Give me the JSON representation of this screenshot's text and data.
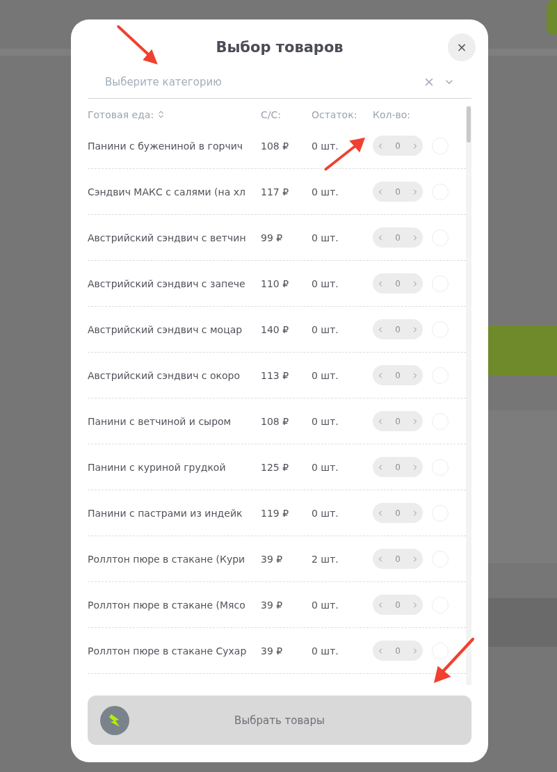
{
  "dialog": {
    "title": "Выбор товаров",
    "close": "×"
  },
  "category_select": {
    "placeholder": "Выберите категорию"
  },
  "table": {
    "columns": [
      "Готовая еда:",
      "С/С:",
      "Остаток:",
      "Кол-во:"
    ],
    "rows": [
      {
        "name": "Панини с бужениной в горчич",
        "price": "108 ₽",
        "stock": "0 шт.",
        "qty": "0",
        "checked": false,
        "disabled": true
      },
      {
        "name": "Сэндвич МАКС с салями (на хл",
        "price": "117 ₽",
        "stock": "0 шт.",
        "qty": "0",
        "checked": false,
        "disabled": true
      },
      {
        "name": "Австрийский сэндвич с ветчин",
        "price": "99 ₽",
        "stock": "0 шт.",
        "qty": "0",
        "checked": false,
        "disabled": true
      },
      {
        "name": "Австрийский сэндвич с запече",
        "price": "110 ₽",
        "stock": "0 шт.",
        "qty": "0",
        "checked": false,
        "disabled": true
      },
      {
        "name": "Австрийский сэндвич с моцар",
        "price": "140 ₽",
        "stock": "0 шт.",
        "qty": "0",
        "checked": false,
        "disabled": true
      },
      {
        "name": "Австрийский сэндвич с окоро",
        "price": "113 ₽",
        "stock": "0 шт.",
        "qty": "0",
        "checked": false,
        "disabled": true
      },
      {
        "name": "Панини с ветчиной и сыром",
        "price": "108 ₽",
        "stock": "0 шт.",
        "qty": "0",
        "checked": false,
        "disabled": true
      },
      {
        "name": "Панини с куриной грудкой",
        "price": "125 ₽",
        "stock": "0 шт.",
        "qty": "0",
        "checked": false,
        "disabled": true
      },
      {
        "name": "Панини с пастрами из индейк",
        "price": "119 ₽",
        "stock": "0 шт.",
        "qty": "0",
        "checked": false,
        "disabled": true
      },
      {
        "name": "Роллтон пюре в стакане (Кури",
        "price": "39 ₽",
        "stock": "2 шт.",
        "qty": "0",
        "checked": false,
        "disabled": true
      },
      {
        "name": "Роллтон пюре в стакане (Мясо",
        "price": "39 ₽",
        "stock": "0 шт.",
        "qty": "0",
        "checked": false,
        "disabled": true
      },
      {
        "name": "Роллтон пюре в стакане Сухар",
        "price": "39 ₽",
        "stock": "0 шт.",
        "qty": "0",
        "checked": false,
        "disabled": true
      }
    ]
  },
  "submit_button": {
    "label": "Выбрать товары",
    "disabled": true
  }
}
